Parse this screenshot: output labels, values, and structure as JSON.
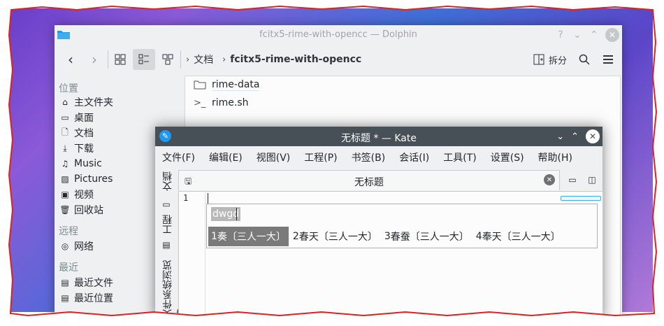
{
  "dolphin": {
    "title": "fcitx5-rime-with-opencc — Dolphin",
    "toolbar": {
      "breadcrumbs": [
        "文档",
        "fcitx5-rime-with-opencc"
      ],
      "split_label": "拆分"
    },
    "sidebar": {
      "sections": [
        {
          "heading": "位置",
          "items": [
            {
              "label": "主文件夹",
              "icon": "home-icon"
            },
            {
              "label": "桌面",
              "icon": "desktop-icon"
            },
            {
              "label": "文档",
              "icon": "document-icon"
            },
            {
              "label": "下载",
              "icon": "download-icon"
            },
            {
              "label": "Music",
              "icon": "music-icon"
            },
            {
              "label": "Pictures",
              "icon": "picture-icon"
            },
            {
              "label": "视频",
              "icon": "video-icon"
            },
            {
              "label": "回收站",
              "icon": "trash-icon"
            }
          ]
        },
        {
          "heading": "远程",
          "items": [
            {
              "label": "网络",
              "icon": "network-icon"
            }
          ]
        },
        {
          "heading": "最近",
          "items": [
            {
              "label": "最近文件",
              "icon": "recent-files-icon"
            },
            {
              "label": "最近位置",
              "icon": "recent-locations-icon"
            }
          ]
        }
      ]
    },
    "files": [
      {
        "name": "rime-data",
        "icon": "folder-icon"
      },
      {
        "name": "rime.sh",
        "icon": "terminal-script-icon"
      }
    ]
  },
  "kate": {
    "title": "无标题 * — Kate",
    "menu": [
      "文件(F)",
      "编辑(E)",
      "视图(V)",
      "工程(P)",
      "书签(B)",
      "会话(I)",
      "工具(T)",
      "设置(S)",
      "帮助(H)"
    ],
    "side_tabs": [
      "文档",
      "工程",
      "文件系统浏览器"
    ],
    "tab_label": "无标题",
    "line_number": "1"
  },
  "ime": {
    "preedit": "dwgd",
    "candidates": [
      {
        "index": "1",
        "text": "奏",
        "comment": "〔三人一大〕"
      },
      {
        "index": "2",
        "text": "春天",
        "comment": "〔三人一大〕"
      },
      {
        "index": "3",
        "text": "春蚕",
        "comment": "〔三人一大〕"
      },
      {
        "index": "4",
        "text": "奉天",
        "comment": "〔三人一大〕"
      }
    ],
    "selected_index": 0
  },
  "colors": {
    "kate_titlebar": "#475057",
    "selected_candidate": "#7a7a7a",
    "border_red": "#e02020",
    "accent": "#3daee9"
  }
}
